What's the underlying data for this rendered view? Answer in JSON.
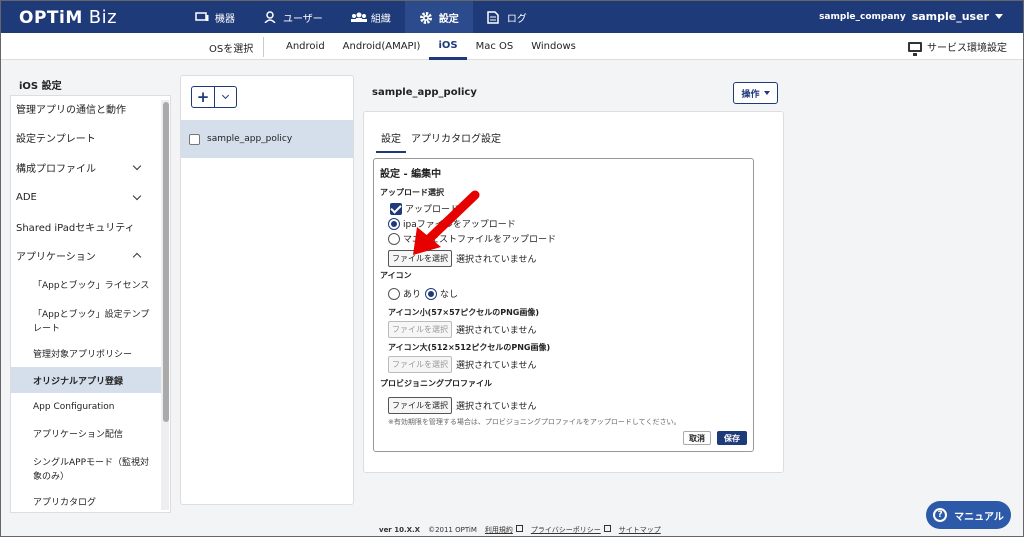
{
  "header": {
    "logo": "OPTiM",
    "logo_biz": "Biz",
    "nav": [
      {
        "label": "機器",
        "icon": "device-icon"
      },
      {
        "label": "ユーザー",
        "icon": "user-icon"
      },
      {
        "label": "組織",
        "icon": "organization-icon"
      },
      {
        "label": "設定",
        "icon": "gear-icon",
        "active": true
      },
      {
        "label": "ログ",
        "icon": "log-icon"
      }
    ],
    "company": "sample_company",
    "user": "sample_user"
  },
  "subnav": {
    "os_select": "OSを選択",
    "tabs": [
      "Android",
      "Android(AMAPI)",
      "iOS",
      "Mac OS",
      "Windows"
    ],
    "active_tab": "iOS",
    "service_setting": "サービス環境設定"
  },
  "sidebar": {
    "title": "iOS 設定",
    "items": [
      {
        "label": "管理アプリの通信と動作"
      },
      {
        "label": "設定テンプレート"
      },
      {
        "label": "構成プロファイル"
      },
      {
        "label": "ADE"
      },
      {
        "label": "Shared iPadセキュリティ"
      },
      {
        "label": "アプリケーション"
      },
      {
        "label": "「Appとブック」ライセンス"
      },
      {
        "label": "「Appとブック」設定テンプ"
      },
      {
        "label": "レート"
      },
      {
        "label": "管理対象アプリポリシー"
      },
      {
        "label": "オリジナルアプリ登録"
      },
      {
        "label": "App Configuration"
      },
      {
        "label": "アプリケーション配信"
      },
      {
        "label": "シングルAPPモード（監視対"
      },
      {
        "label": "象のみ）"
      },
      {
        "label": "アプリカタログ"
      }
    ]
  },
  "list": {
    "add_label": "+",
    "items": [
      "sample_app_policy"
    ]
  },
  "detail": {
    "title": "sample_app_policy",
    "ops_label": "操作",
    "tabs": [
      "設定",
      "アプリカタログ設定"
    ],
    "edit_title": "設定 - 編集中",
    "upload_select_label": "アップロード選択",
    "upload_checkbox": "アップロード",
    "radio_ipa": "ipaファイルをアップロード",
    "radio_manifest": "マニフェストファイルをアップロード",
    "choose_file": "ファイルを選択",
    "no_file": "選択されていません",
    "icon_label": "アイコン",
    "icon_yes": "あり",
    "icon_no": "なし",
    "icon_small_label": "アイコン小(57×57ピクセルのPNG画像)",
    "icon_large_label": "アイコン大(512×512ピクセルのPNG画像)",
    "provision_label": "プロビジョニングプロファイル",
    "note": "※有効期限を管理する場合は、プロビジョニングプロファイルをアップロードしてください。",
    "cancel": "取消",
    "save": "保存"
  },
  "footer": {
    "version": "ver 10.X.X",
    "copyright": "©2011 OPTiM",
    "terms": "利用規約",
    "privacy": "プライバシーポリシー",
    "sitemap": "サイトマップ"
  },
  "manual_button": "マニュアル",
  "colors": {
    "brand": "#1e3a78",
    "annotation_arrow": "#e60000"
  }
}
